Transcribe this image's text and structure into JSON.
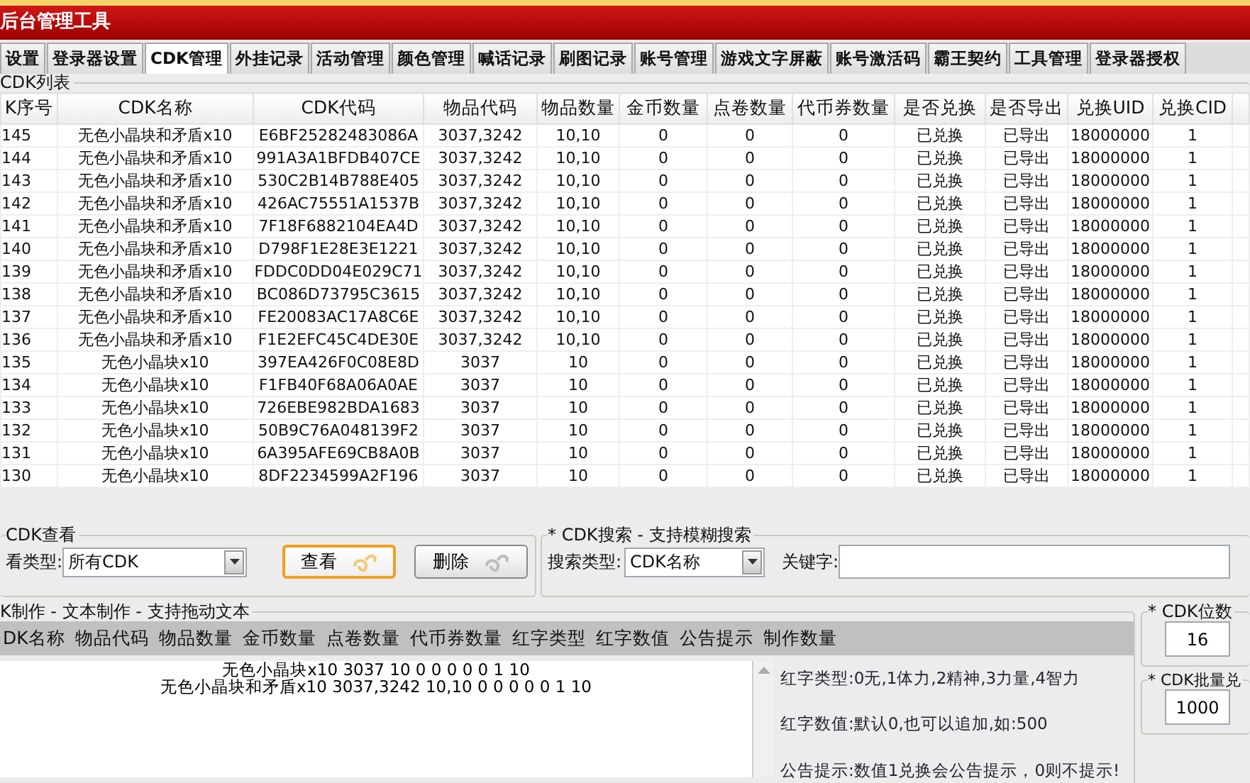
{
  "window": {
    "title": "后台管理工具"
  },
  "tabs": [
    {
      "label": "设置",
      "selected": false
    },
    {
      "label": "登录器设置",
      "selected": false
    },
    {
      "label": "CDK管理",
      "selected": true
    },
    {
      "label": "外挂记录",
      "selected": false
    },
    {
      "label": "活动管理",
      "selected": false
    },
    {
      "label": "颜色管理",
      "selected": false
    },
    {
      "label": "喊话记录",
      "selected": false
    },
    {
      "label": "刷图记录",
      "selected": false
    },
    {
      "label": "账号管理",
      "selected": false
    },
    {
      "label": "游戏文字屏蔽",
      "selected": false
    },
    {
      "label": "账号激活码",
      "selected": false
    },
    {
      "label": "霸王契约",
      "selected": false
    },
    {
      "label": "工具管理",
      "selected": false
    },
    {
      "label": "登录器授权",
      "selected": false
    }
  ],
  "cdk_list": {
    "title": "CDK列表",
    "columns": [
      "K序号",
      "CDK名称",
      "CDK代码",
      "物品代码",
      "物品数量",
      "金币数量",
      "点卷数量",
      "代币券数量",
      "是否兑换",
      "是否导出",
      "兑换UID",
      "兑换CID"
    ],
    "rows": [
      [
        "145",
        "无色小晶块和矛盾x10",
        "E6BF25282483086A",
        "3037,3242",
        "10,10",
        "0",
        "0",
        "0",
        "已兑换",
        "已导出",
        "18000000",
        "1"
      ],
      [
        "144",
        "无色小晶块和矛盾x10",
        "991A3A1BFDB407CE",
        "3037,3242",
        "10,10",
        "0",
        "0",
        "0",
        "已兑换",
        "已导出",
        "18000000",
        "1"
      ],
      [
        "143",
        "无色小晶块和矛盾x10",
        "530C2B14B788E405",
        "3037,3242",
        "10,10",
        "0",
        "0",
        "0",
        "已兑换",
        "已导出",
        "18000000",
        "1"
      ],
      [
        "142",
        "无色小晶块和矛盾x10",
        "426AC75551A1537B",
        "3037,3242",
        "10,10",
        "0",
        "0",
        "0",
        "已兑换",
        "已导出",
        "18000000",
        "1"
      ],
      [
        "141",
        "无色小晶块和矛盾x10",
        "7F18F6882104EA4D",
        "3037,3242",
        "10,10",
        "0",
        "0",
        "0",
        "已兑换",
        "已导出",
        "18000000",
        "1"
      ],
      [
        "140",
        "无色小晶块和矛盾x10",
        "D798F1E28E3E1221",
        "3037,3242",
        "10,10",
        "0",
        "0",
        "0",
        "已兑换",
        "已导出",
        "18000000",
        "1"
      ],
      [
        "139",
        "无色小晶块和矛盾x10",
        "FDDC0DD04E029C71",
        "3037,3242",
        "10,10",
        "0",
        "0",
        "0",
        "已兑换",
        "已导出",
        "18000000",
        "1"
      ],
      [
        "138",
        "无色小晶块和矛盾x10",
        "BC086D73795C3615",
        "3037,3242",
        "10,10",
        "0",
        "0",
        "0",
        "已兑换",
        "已导出",
        "18000000",
        "1"
      ],
      [
        "137",
        "无色小晶块和矛盾x10",
        "FE20083AC17A8C6E",
        "3037,3242",
        "10,10",
        "0",
        "0",
        "0",
        "已兑换",
        "已导出",
        "18000000",
        "1"
      ],
      [
        "136",
        "无色小晶块和矛盾x10",
        "F1E2EFC45C4DE30E",
        "3037,3242",
        "10,10",
        "0",
        "0",
        "0",
        "已兑换",
        "已导出",
        "18000000",
        "1"
      ],
      [
        "135",
        "无色小晶块x10",
        "397EA426F0C08E8D",
        "3037",
        "10",
        "0",
        "0",
        "0",
        "已兑换",
        "已导出",
        "18000000",
        "1"
      ],
      [
        "134",
        "无色小晶块x10",
        "F1FB40F68A06A0AE",
        "3037",
        "10",
        "0",
        "0",
        "0",
        "已兑换",
        "已导出",
        "18000000",
        "1"
      ],
      [
        "133",
        "无色小晶块x10",
        "726EBE982BDA1683",
        "3037",
        "10",
        "0",
        "0",
        "0",
        "已兑换",
        "已导出",
        "18000000",
        "1"
      ],
      [
        "132",
        "无色小晶块x10",
        "50B9C76A048139F2",
        "3037",
        "10",
        "0",
        "0",
        "0",
        "已兑换",
        "已导出",
        "18000000",
        "1"
      ],
      [
        "131",
        "无色小晶块x10",
        "6A395AFE69CB8A0B",
        "3037",
        "10",
        "0",
        "0",
        "0",
        "已兑换",
        "已导出",
        "18000000",
        "1"
      ],
      [
        "130",
        "无色小晶块x10",
        "8DF2234599A2F196",
        "3037",
        "10",
        "0",
        "0",
        "0",
        "已兑换",
        "已导出",
        "18000000",
        "1"
      ]
    ]
  },
  "cdk_view": {
    "title": "CDK查看",
    "type_label": "看类型:",
    "type_value": "所有CDK",
    "view_button": "查看",
    "delete_button": "删除"
  },
  "cdk_search": {
    "title": "* CDK搜索 - 支持模糊搜索",
    "type_label": "搜索类型:",
    "type_value": "CDK名称",
    "keyword_label": "关键字:"
  },
  "cdk_make": {
    "title": "K制作 - 文本制作 - 支持拖动文本",
    "fields": [
      "DK名称",
      "物品代码",
      "物品数量",
      "金币数量",
      "点卷数量",
      "代币券数量",
      "红字类型",
      "红字数值",
      "公告提示",
      "制作数量"
    ],
    "text": [
      "无色小晶块x10 3037 10 0 0 0 0 0 1 10",
      "无色小晶块和矛盾x10 3037,3242 10,10 0 0 0 0 0 1 10"
    ],
    "hints": [
      "红字类型:0无,1体力,2精神,3力量,4智力",
      "红字数值:默认0,也可以追加,如:500",
      "公告提示:数值1兑换会公告提示，0则不提示!"
    ]
  },
  "cdk_digits": {
    "title": "* CDK位数",
    "value": "16"
  },
  "cdk_batch": {
    "title": "* CDK批量兑",
    "value": "1000"
  }
}
